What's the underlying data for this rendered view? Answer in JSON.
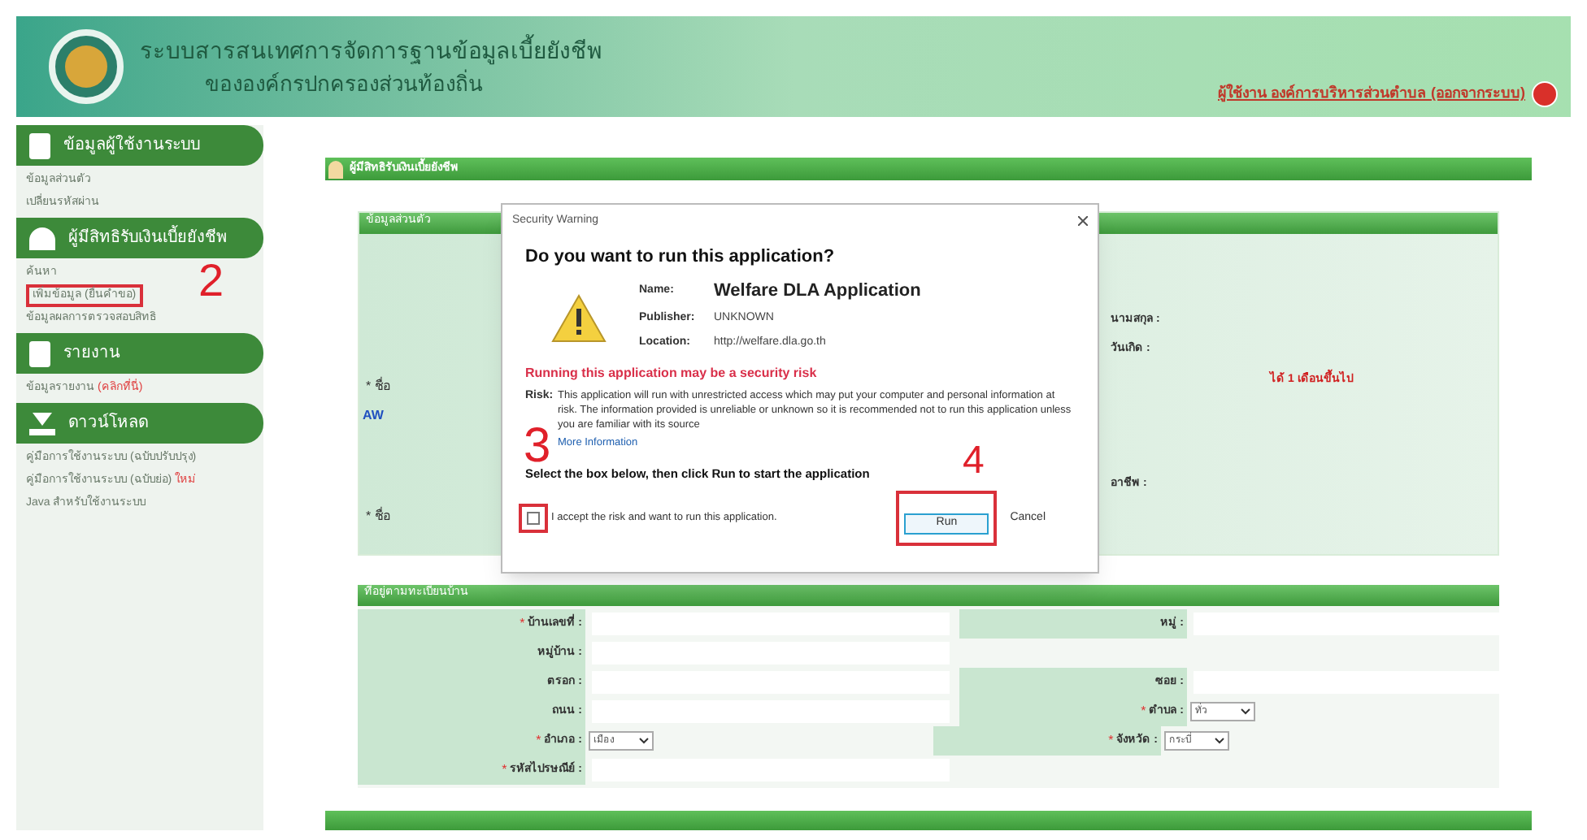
{
  "header": {
    "title_line1": "ระบบสารสนเทศการจัดการฐานข้อมูลเบี้ยยังชีพ",
    "title_line2": "ขององค์กรปกครองส่วนท้องถิ่น",
    "user_link": "ผู้ใช้งาน องค์การบริหารส่วนตำบล (ออกจากระบบ)"
  },
  "sidebar": {
    "sections": [
      {
        "title": "ข้อมูลผู้ใช้งานระบบ",
        "items": [
          {
            "label": "ข้อมูลส่วนตัว",
            "outlined": false
          },
          {
            "label": "เปลี่ยนรหัสผ่าน",
            "outlined": false
          }
        ]
      },
      {
        "title": "ผู้มีสิทธิรับเงินเบี้ยยังชีพ",
        "marker": "2",
        "items": [
          {
            "label": "ค้นหา",
            "outlined": false
          },
          {
            "label": "เพิ่มข้อมูล (ยื่นคำขอ)",
            "outlined": true
          },
          {
            "label": "ข้อมูลผลการตรวจสอบสิทธิ",
            "outlined": false
          }
        ]
      },
      {
        "title": "รายงาน",
        "items": [
          {
            "label": "ข้อมูลรายงาน",
            "outlined": false,
            "tag": "(คลิกที่นี่)"
          }
        ]
      },
      {
        "title": "ดาวน์โหลด",
        "items": [
          {
            "label": "คู่มือการใช้งานระบบ (ฉบับปรับปรุง)",
            "outlined": false
          },
          {
            "label": "คู่มือการใช้งานระบบ (ฉบับย่อ)",
            "outlined": false,
            "tag": "ใหม่"
          },
          {
            "label": "Java สำหรับใช้งานระบบ",
            "outlined": false
          }
        ]
      }
    ]
  },
  "main": {
    "page_title": "ผู้มีสิทธิรับเงินเบี้ยยังชีพ",
    "section1": {
      "title": "ข้อมูลส่วนตัว",
      "right_labels": [
        "นามสกุล :",
        "วันเกิด :",
        "อาชีพ :"
      ],
      "left_marks": [
        "* ชื่อ",
        "* ชื่อ"
      ],
      "note": "ได้ 1 เดือนขึ้นไป",
      "link": "AW"
    },
    "section2": {
      "title": "ที่อยู่ตามทะเบียนบ้าน",
      "rows": [
        {
          "left": {
            "label": "บ้านเลขที่ :",
            "mark": "*",
            "kind": "input"
          },
          "right": {
            "label": "หมู่ :",
            "kind": "input"
          }
        },
        {
          "left": {
            "label": "หมู่บ้าน :",
            "kind": "input"
          }
        },
        {
          "left": {
            "label": "ตรอก :",
            "kind": "input"
          },
          "right": {
            "label": "ซอย :",
            "kind": "input"
          }
        },
        {
          "left": {
            "label": "ถนน :",
            "kind": "input"
          },
          "right": {
            "label": "ตำบล :",
            "mark": "*",
            "kind": "select",
            "value": "ทั่ว"
          }
        },
        {
          "left": {
            "label": "อำเภอ :",
            "mark": "*",
            "kind": "select",
            "value": "เมือง"
          },
          "right": {
            "label": "จังหวัด :",
            "mark": "*",
            "kind": "select",
            "value": "กระบี่"
          }
        },
        {
          "left": {
            "label": "รหัสไปรษณีย์ :",
            "mark": "*",
            "kind": "input"
          }
        }
      ]
    }
  },
  "dialog": {
    "title": "Security Warning",
    "question": "Do you want to run this application?",
    "fields": [
      {
        "label": "Name:",
        "value": "Welfare DLA Application",
        "kind": "big"
      },
      {
        "label": "Publisher:",
        "value": "UNKNOWN",
        "kind": "small"
      },
      {
        "label": "Location:",
        "value": "http://welfare.dla.go.th",
        "kind": "small"
      }
    ],
    "risk_heading": "Running this application may be a security risk",
    "risk_label": "Risk:",
    "risk_text": "This application will run with unrestricted access which may put your computer and personal information at risk. The information provided is unreliable or unknown so it is recommended not to run this application unless you are familiar with its source",
    "more_info": "More Information",
    "instruction": "Select the box below, then click Run to start the application",
    "accept": {
      "label": "I accept the risk and want to run this application.",
      "checked": false,
      "outlined": true,
      "marker": "3"
    },
    "run": {
      "label": "Run",
      "outlined": true,
      "marker": "4"
    },
    "cancel": "Cancel"
  }
}
